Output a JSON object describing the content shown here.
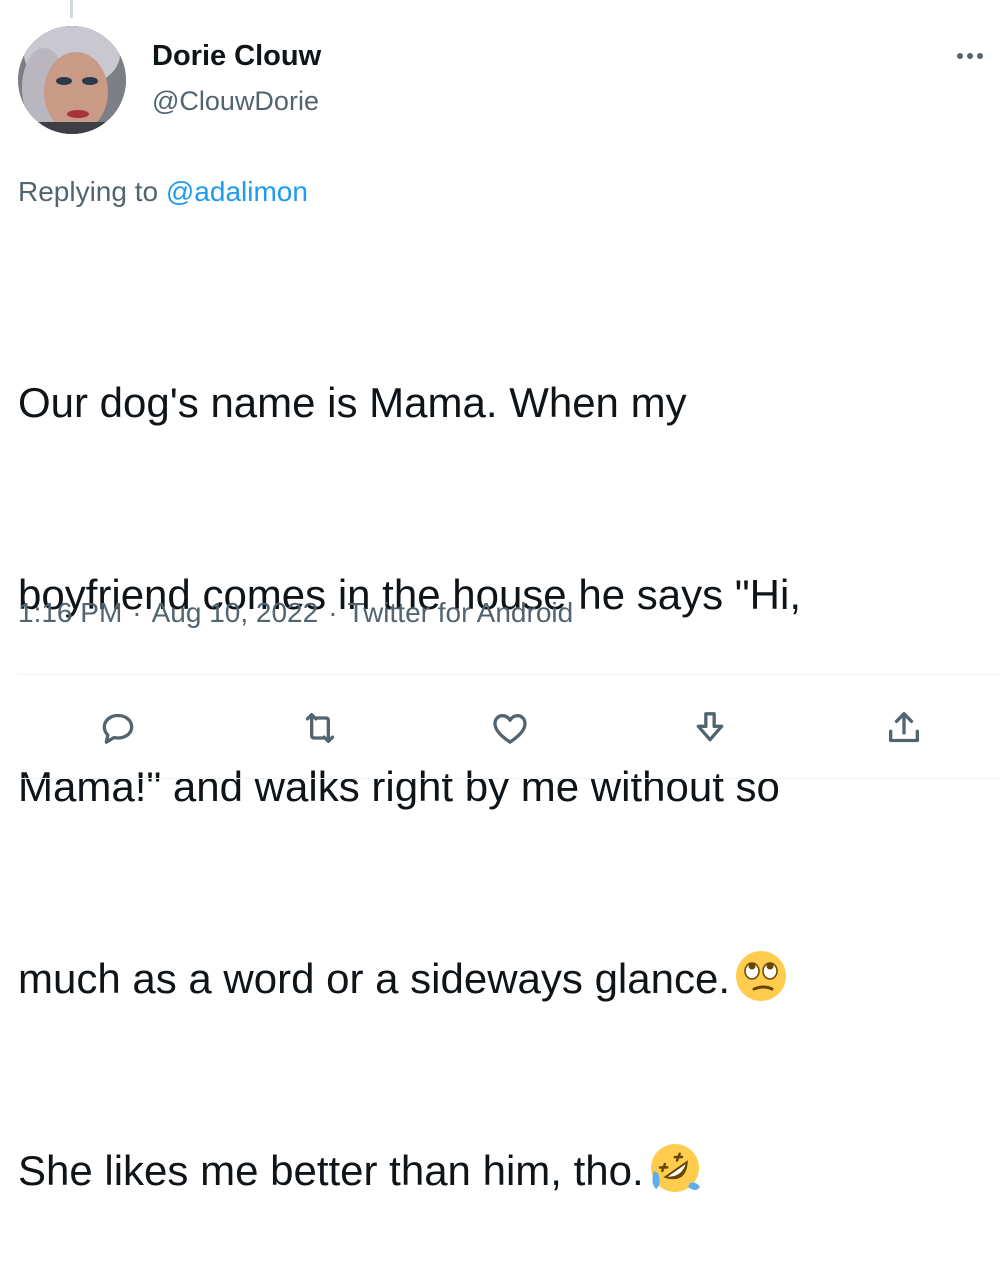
{
  "author": {
    "name": "Dorie Clouw",
    "handle": "@ClouwDorie"
  },
  "reply": {
    "prefix": "Replying to",
    "mention": "@adalimon"
  },
  "tweet": {
    "lines": [
      "Our dog's name is Mama. When my",
      "boyfriend comes in the house he says \"Hi,",
      "Mama!\" and walks right by me without so",
      "much as a word or a sideways glance.",
      "She likes me better than him, tho."
    ],
    "emojis": [
      "face-with-rolling-eyes",
      "rolling-on-the-floor-laughing"
    ]
  },
  "meta": {
    "time": "1:16 PM",
    "date": "Aug 10, 2022",
    "source": "Twitter for Android",
    "separator": "·"
  },
  "actions": [
    "reply-icon",
    "retweet-icon",
    "like-icon",
    "download-icon",
    "share-icon"
  ],
  "colors": {
    "text": "#0f1419",
    "secondary": "#536471",
    "link": "#1d9bf0",
    "divider": "#eff3f4"
  }
}
